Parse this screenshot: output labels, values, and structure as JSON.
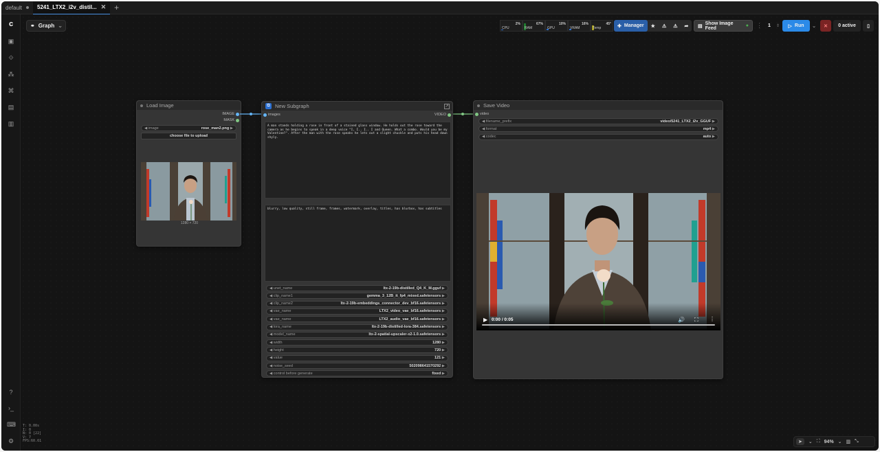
{
  "tabs": [
    {
      "label": "default"
    },
    {
      "label": "5241_LTX2_i2v_distil..."
    }
  ],
  "graph_label": "Graph",
  "meters": [
    {
      "label": "CPU",
      "value": "2%",
      "fill": 0.02,
      "color": "#2b6fd1"
    },
    {
      "label": "RAM",
      "value": "67%",
      "fill": 0.67,
      "color": "#1f7a2e"
    },
    {
      "label": "GPU",
      "value": "10%",
      "fill": 0.1,
      "color": "#2b6fd1"
    },
    {
      "label": "VRAM",
      "value": "16%",
      "fill": 0.16,
      "color": "#2b6fd1"
    },
    {
      "label": "Temp",
      "value": "45°",
      "fill": 0.45,
      "color": "#a8a020"
    }
  ],
  "toolbar": {
    "manager": "Manager",
    "show_image_feed": "Show Image Feed",
    "queue_count": "1",
    "run": "Run",
    "active": "0 active"
  },
  "stats": {
    "t": "T: 0.00s",
    "i": "I: 0",
    "n": "N: 0 [22]",
    "v": "V: 7",
    "fps": "FPS:60.61"
  },
  "load_image": {
    "title": "Load Image",
    "out_image": "IMAGE",
    "out_mask": "MASK",
    "image_label": "image",
    "image_value": "rose_man2.png",
    "upload": "choose file to upload",
    "dims": "1280 × 720"
  },
  "subgraph": {
    "title": "New Subgraph",
    "in_images": "images",
    "out_video": "VIDEO",
    "prompt": "A man stands holding a rose in front of a stained glass window. He holds out the rose toward the camera as he begins to speak in a deep voice \"I, I.. I.. I and Queen. What a combo. Would you be my Valentine?\". After the man with the rose speaks he lets out a slight chuckle and puts his head down shyly.",
    "negative": "blurry, low quality, still frame, frames, watermark, overlay, titles, has blurbox, has subtitles",
    "widgets": [
      {
        "label": "unet_name",
        "value": "ltx-2-19b-distilled_Q4_K_M.gguf"
      },
      {
        "label": "clip_name1",
        "value": "gemma_3_12B_it_fp4_mixed.safetensors"
      },
      {
        "label": "clip_name2",
        "value": "ltx-2-19b-embeddings_connector_dev_bf16.safetensors"
      },
      {
        "label": "vae_name",
        "value": "LTX2_video_vae_bf16.safetensors"
      },
      {
        "label": "vae_name",
        "value": "LTX2_audio_vae_bf16.safetensors"
      },
      {
        "label": "lora_name",
        "value": "ltx-2-19b-distilled-lora-384.safetensors"
      },
      {
        "label": "model_name",
        "value": "ltx-2-spatial-upscaler-x2-1.0.safetensors"
      },
      {
        "label": "width",
        "value": "1280"
      },
      {
        "label": "height",
        "value": "720"
      },
      {
        "label": "value",
        "value": "121"
      },
      {
        "label": "noise_seed",
        "value": "502098641570292"
      },
      {
        "label": "control before generate",
        "value": "fixed"
      }
    ]
  },
  "save_video": {
    "title": "Save Video",
    "in_video": "video",
    "widgets": [
      {
        "label": "filename_prefix",
        "value": "video/5241_LTX2_i2v_GGUF"
      },
      {
        "label": "format",
        "value": "mp4"
      },
      {
        "label": "codec",
        "value": "auto"
      }
    ],
    "time": "0:00 / 0:05"
  },
  "zoom": "94%"
}
